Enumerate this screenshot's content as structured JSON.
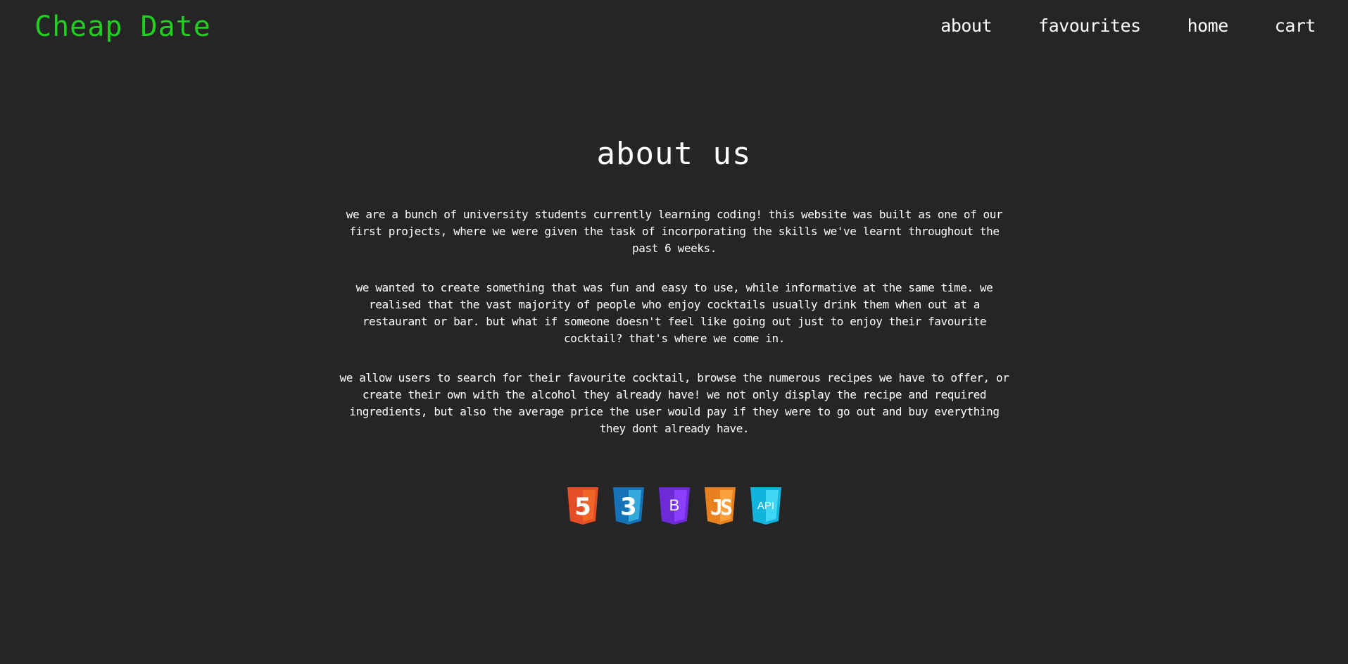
{
  "header": {
    "logo": "Cheap Date",
    "nav": [
      {
        "label": "about"
      },
      {
        "label": "favourites"
      },
      {
        "label": "home"
      },
      {
        "label": "cart"
      }
    ]
  },
  "main": {
    "title": "about us",
    "paragraphs": [
      "we are a bunch of university students currently learning coding! this website was built as one of our first projects, where we were given the task of incorporating the skills we've learnt throughout the past 6 weeks.",
      "we wanted to create something that was fun and easy to use, while informative at the same time. we realised that the vast majority of people who enjoy cocktails usually drink them when out at a restaurant or bar. but what if someone doesn't feel like going out just to enjoy their favourite cocktail? that's where we come in.",
      "we allow users to search for their favourite cocktail, browse the numerous recipes we have to offer, or create their own with the alcohol they already have! we not only display the recipe and required ingredients, but also the average price the user would pay if they were to go out and buy everything they dont already have."
    ],
    "tech_badges": [
      {
        "icon": "html5-icon",
        "label": "5",
        "color": "#e44d26"
      },
      {
        "icon": "css3-icon",
        "label": "3",
        "color": "#1572b6"
      },
      {
        "icon": "bootstrap-icon",
        "label": "B",
        "color": "#7a2cf0"
      },
      {
        "icon": "javascript-icon",
        "label": "JS",
        "color": "#f08a24"
      },
      {
        "icon": "api-icon",
        "label": "API",
        "color": "#1fc8ef"
      }
    ]
  },
  "colors": {
    "background": "#252525",
    "logo": "#1fd01f",
    "text": "#ffffff"
  }
}
